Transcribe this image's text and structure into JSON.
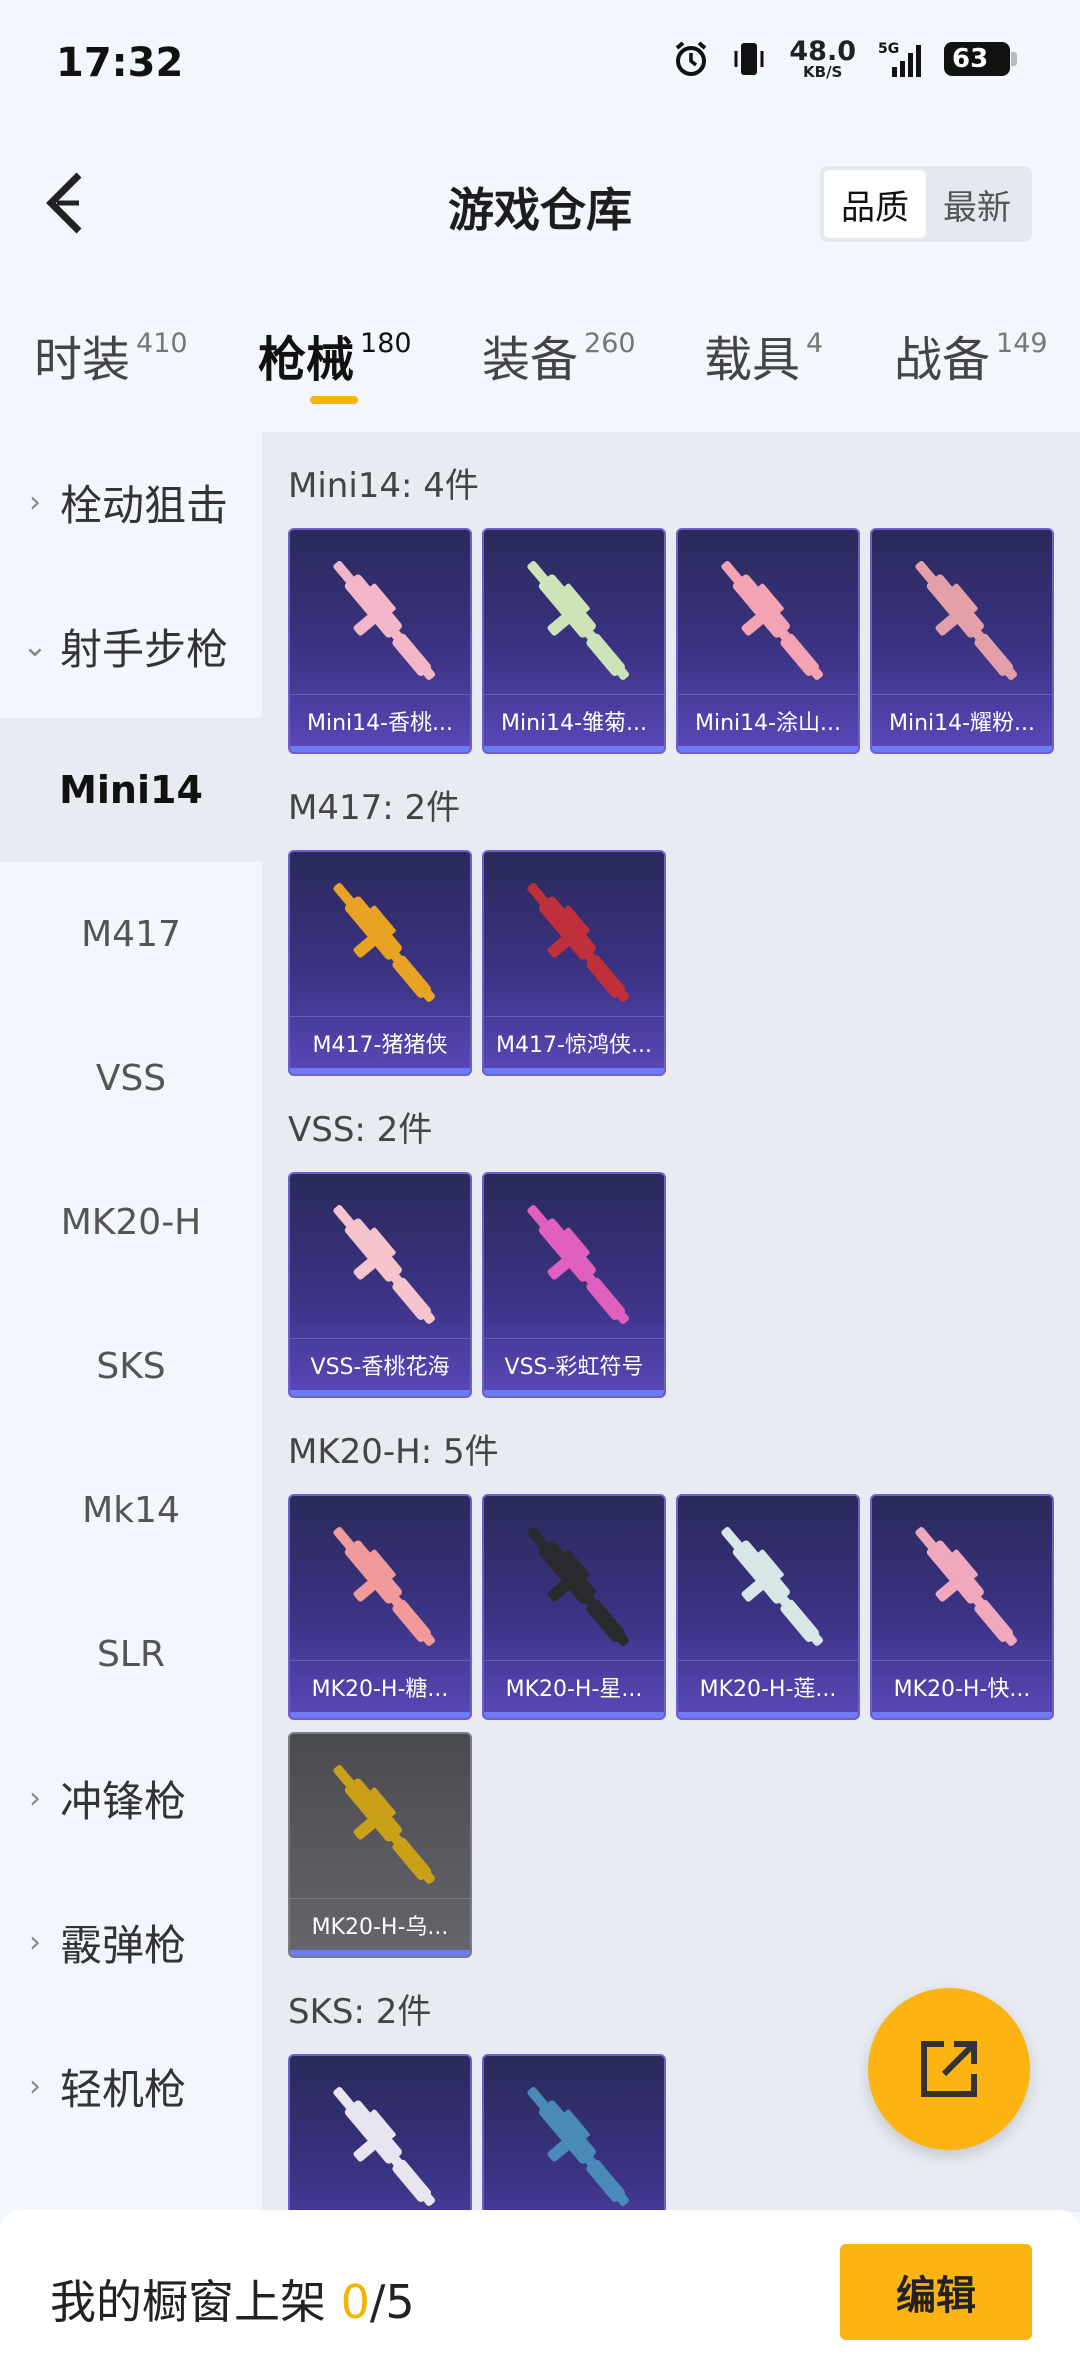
{
  "status_bar": {
    "time": "17:32",
    "speed_value": "48.0",
    "speed_unit": "KB/S",
    "network": "5G",
    "battery": "63"
  },
  "header": {
    "title": "游戏仓库",
    "sort_options": [
      "品质",
      "最新"
    ],
    "sort_active": "品质"
  },
  "tabs": [
    {
      "label": "时装",
      "count": "410"
    },
    {
      "label": "枪械",
      "count": "180"
    },
    {
      "label": "装备",
      "count": "260"
    },
    {
      "label": "载具",
      "count": "4"
    },
    {
      "label": "战备",
      "count": "149"
    }
  ],
  "active_tab": "枪械",
  "sidebar": {
    "groups_top": [
      {
        "label": "栓动狙击",
        "expanded": false
      },
      {
        "label": "射手步枪",
        "expanded": true
      }
    ],
    "sub_items": [
      "Mini14",
      "M417",
      "VSS",
      "MK20-H",
      "SKS",
      "Mk14",
      "SLR"
    ],
    "active_sub": "Mini14",
    "groups_bottom": [
      {
        "label": "冲锋枪",
        "expanded": false
      },
      {
        "label": "霰弹枪",
        "expanded": false
      },
      {
        "label": "轻机枪",
        "expanded": false
      }
    ]
  },
  "sections": [
    {
      "title": "Mini14: 4件",
      "items": [
        "Mini14-香桃...",
        "Mini14-雏菊...",
        "Mini14-涂山...",
        "Mini14-耀粉..."
      ]
    },
    {
      "title": "M417: 2件",
      "items": [
        "M417-猪猪侠",
        "M417-惊鸿侠..."
      ]
    },
    {
      "title": "VSS: 2件",
      "items": [
        "VSS-香桃花海",
        "VSS-彩虹符号"
      ]
    },
    {
      "title": "MK20-H: 5件",
      "items": [
        "MK20-H-糖...",
        "MK20-H-星...",
        "MK20-H-莲...",
        "MK20-H-快...",
        "MK20-H-乌..."
      ]
    },
    {
      "title": "SKS: 2件",
      "items": [
        "",
        ""
      ]
    }
  ],
  "gun_colors": {
    "Mini14-香桃...": "#f2b6c8",
    "Mini14-雏菊...": "#cfe3b8",
    "Mini14-涂山...": "#f3a3b4",
    "Mini14-耀粉...": "#e3a0a8",
    "M417-猪猪侠": "#e8a224",
    "M417-惊鸿侠...": "#c0303a",
    "VSS-香桃花海": "#f5c4cc",
    "VSS-彩虹符号": "#e060c0",
    "MK20-H-糖...": "#f09a9a",
    "MK20-H-星...": "#2a2a2e",
    "MK20-H-莲...": "#d8e6e8",
    "MK20-H-快...": "#f0a8bc",
    "MK20-H-乌...": "#c9a018"
  },
  "bottom_bar": {
    "label": "我的橱窗上架",
    "used": "0",
    "total": "/5",
    "edit_label": "编辑"
  },
  "accent_color": "#f5b400"
}
